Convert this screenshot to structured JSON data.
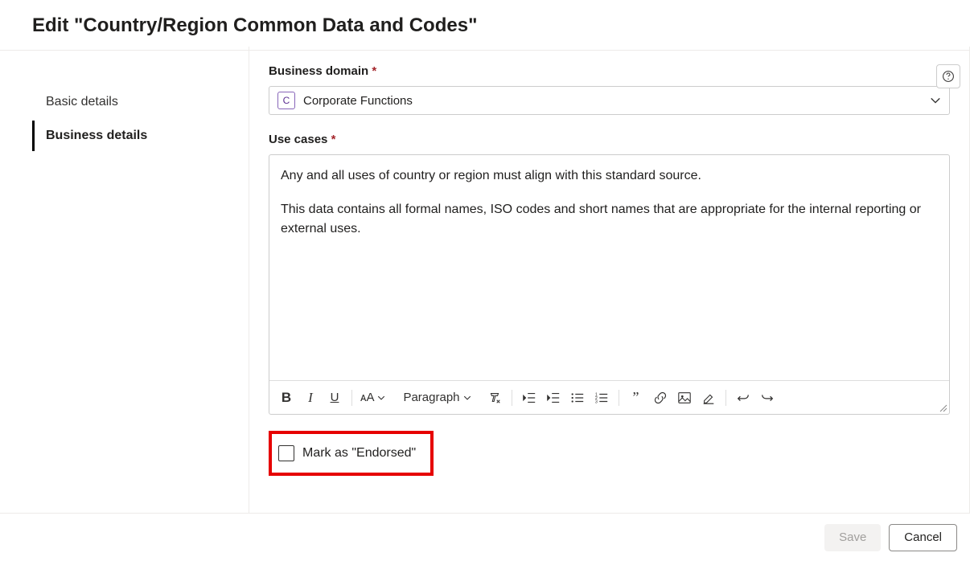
{
  "header": {
    "title": "Edit \"Country/Region Common Data and Codes\""
  },
  "sidebar": {
    "items": [
      {
        "label": "Basic details",
        "active": false
      },
      {
        "label": "Business details",
        "active": true
      }
    ]
  },
  "main": {
    "business_domain": {
      "label": "Business domain",
      "required_mark": "*",
      "chip_letter": "C",
      "value": "Corporate Functions"
    },
    "use_cases": {
      "label": "Use cases",
      "required_mark": "*",
      "paragraph1": "Any and all uses of country or region must align with this standard source.",
      "paragraph2": "This data contains all formal names, ISO codes and short names that are appropriate for the internal reporting or external uses."
    },
    "toolbar": {
      "font_size_label": "ᴀA",
      "paragraph_label": "Paragraph"
    },
    "endorse": {
      "label": "Mark as \"Endorsed\"",
      "checked": false
    }
  },
  "footer": {
    "save": "Save",
    "cancel": "Cancel"
  }
}
